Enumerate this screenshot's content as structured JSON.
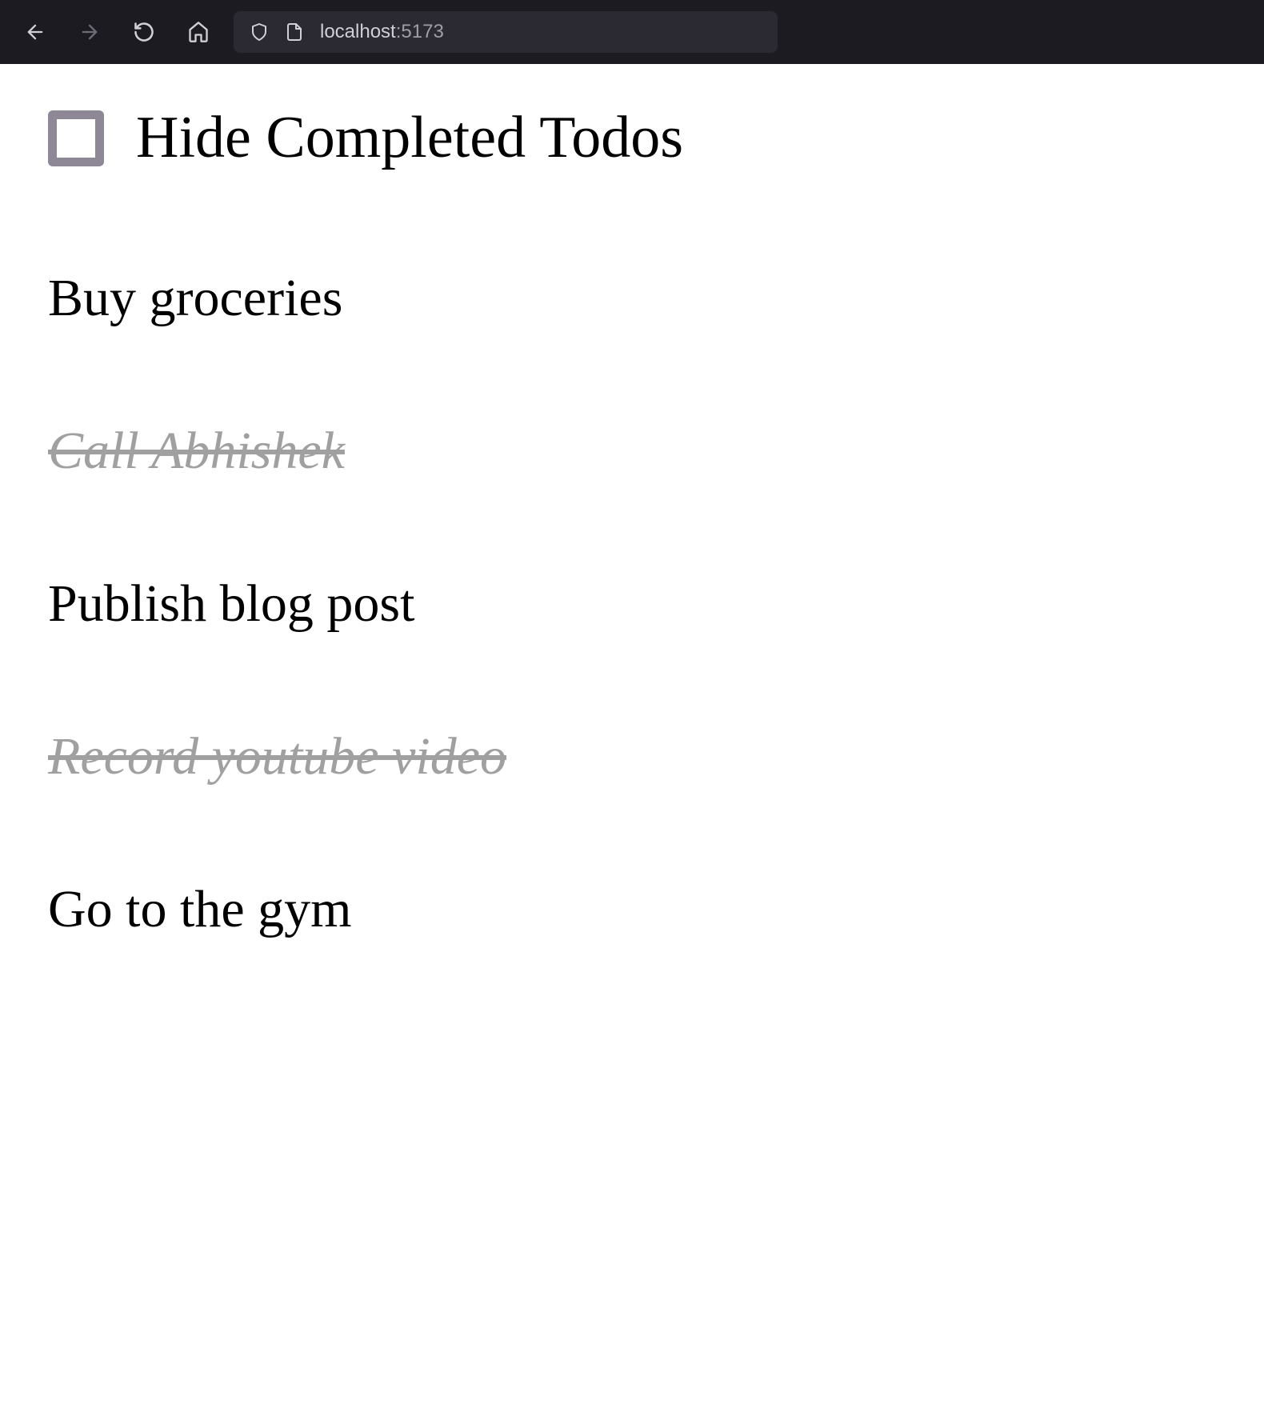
{
  "browser": {
    "url_host": "localhost",
    "url_port": ":5173"
  },
  "filter": {
    "label": "Hide Completed Todos",
    "checked": false
  },
  "todos": [
    {
      "text": "Buy groceries",
      "completed": false
    },
    {
      "text": "Call Abhishek",
      "completed": true
    },
    {
      "text": "Publish blog post",
      "completed": false
    },
    {
      "text": "Record youtube video",
      "completed": true
    },
    {
      "text": "Go to the gym",
      "completed": false
    }
  ]
}
